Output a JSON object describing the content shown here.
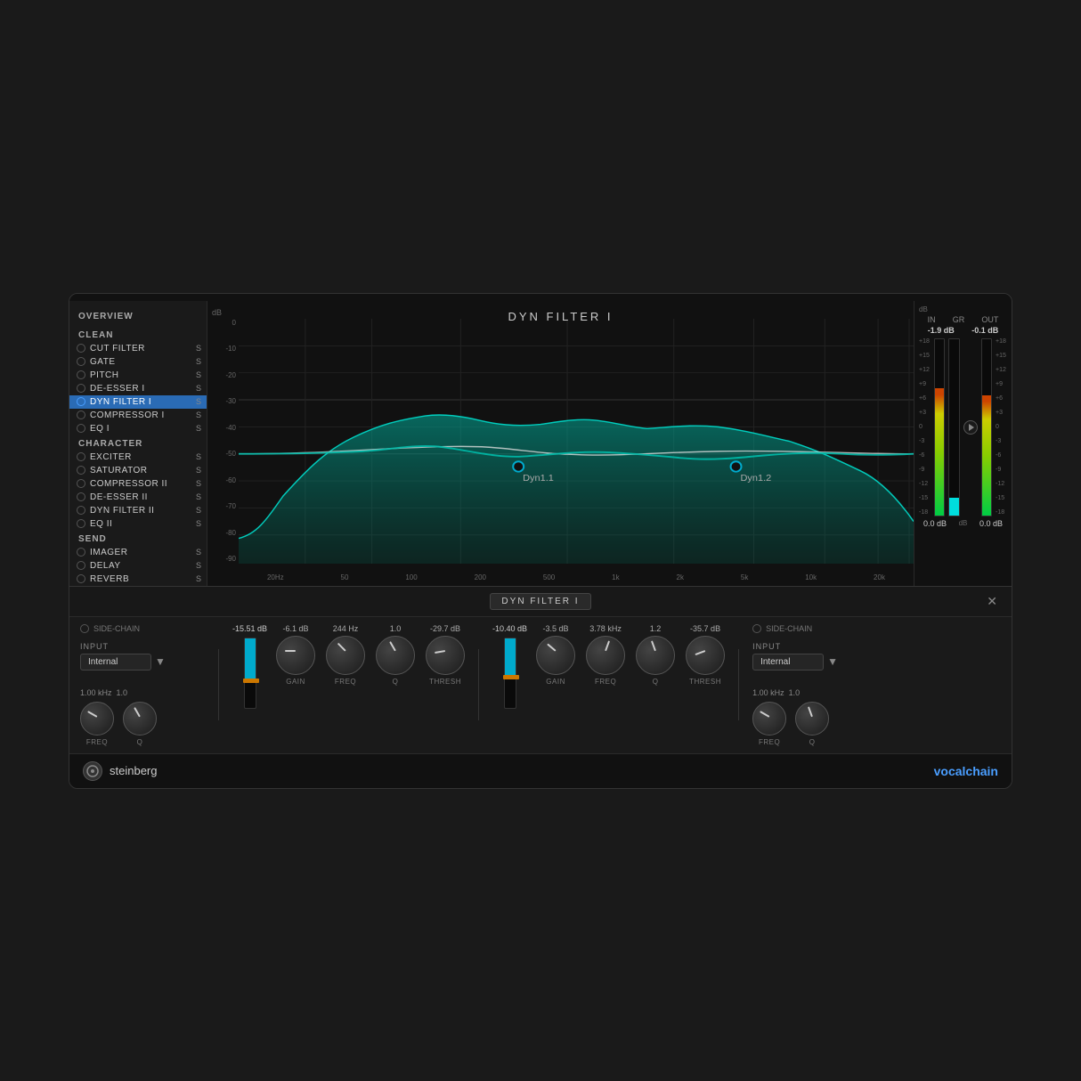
{
  "plugin": {
    "title": "DYN FILTER I",
    "footer": {
      "brand": "steinberg",
      "product_vocal": "vocal",
      "product_chain": "chain"
    }
  },
  "sidebar": {
    "overview": "OVERVIEW",
    "sections": [
      {
        "title": "CLEAN",
        "items": [
          {
            "id": "cut-filter",
            "label": "CUT FILTER",
            "active": false,
            "has_s": true
          },
          {
            "id": "gate",
            "label": "GATE",
            "active": false,
            "has_s": true
          },
          {
            "id": "pitch",
            "label": "PITCH",
            "active": false,
            "has_s": true
          },
          {
            "id": "de-esser-i",
            "label": "DE-ESSER I",
            "active": false,
            "has_s": true
          },
          {
            "id": "dyn-filter-i",
            "label": "DYN FILTER I",
            "active": true,
            "has_s": true
          },
          {
            "id": "compressor-i",
            "label": "COMPRESSOR I",
            "active": false,
            "has_s": true
          },
          {
            "id": "eq-i",
            "label": "EQ I",
            "active": false,
            "has_s": true
          }
        ]
      },
      {
        "title": "CHARACTER",
        "items": [
          {
            "id": "exciter",
            "label": "EXCITER",
            "active": false,
            "has_s": true
          },
          {
            "id": "saturator",
            "label": "SATURATOR",
            "active": false,
            "has_s": true
          },
          {
            "id": "compressor-ii",
            "label": "COMPRESSOR II",
            "active": false,
            "has_s": true
          },
          {
            "id": "de-esser-ii",
            "label": "DE-ESSER II",
            "active": false,
            "has_s": true
          },
          {
            "id": "dyn-filter-ii",
            "label": "DYN FILTER II",
            "active": false,
            "has_s": true
          },
          {
            "id": "eq-ii",
            "label": "EQ II",
            "active": false,
            "has_s": true
          }
        ]
      },
      {
        "title": "SEND",
        "items": [
          {
            "id": "imager",
            "label": "IMAGER",
            "active": false,
            "has_s": true
          },
          {
            "id": "delay",
            "label": "DELAY",
            "active": false,
            "has_s": true
          },
          {
            "id": "reverb",
            "label": "REVERB",
            "active": false,
            "has_s": true
          }
        ]
      }
    ]
  },
  "meters": {
    "in_label": "IN",
    "out_label": "OUT",
    "gr_label": "GR",
    "in_value": "-1.9 dB",
    "gr_value": "-0.1 dB",
    "out_label2": "OUT",
    "db_label": "dB",
    "scale": [
      "+18",
      "+15",
      "+12",
      "+9",
      "+6",
      "+3",
      "0",
      "-3",
      "-6",
      "-9",
      "-12",
      "-15",
      "-18"
    ],
    "bottom_in": "0.0 dB",
    "bottom_out": "0.0 dB"
  },
  "lower_panel": {
    "title": "DYN FILTER I",
    "close_btn": "✕",
    "dyn1": {
      "label": "Dyn1.1",
      "side_chain_label": "SIDE-CHAIN",
      "input_label": "INPUT",
      "input_value": "Internal",
      "freq_val": "1.00 kHz",
      "q_val": "1.0",
      "gain_label": "GAIN",
      "gain_value": "-6.1 dB",
      "freq_label": "FREQ",
      "freq_value": "244 Hz",
      "q_label": "Q",
      "q_value": "1.0",
      "thresh_label": "THRESH",
      "thresh_value": "-29.7 dB",
      "fader_value": "-15.51 dB"
    },
    "dyn2": {
      "label": "Dyn1.2",
      "side_chain_label": "SIDE-CHAIN",
      "input_label": "INPUT",
      "input_value": "Internal",
      "freq_val": "1.00 kHz",
      "q_val": "1.0",
      "gain_label": "GAIN",
      "gain_value": "-3.5 dB",
      "freq_label": "FREQ",
      "freq_value": "3.78 kHz",
      "q_label": "Q",
      "q_value": "1.2",
      "thresh_label": "THRESH",
      "thresh_value": "-35.7 dB",
      "fader_value": "-10.40 dB"
    }
  },
  "eq_display": {
    "db_scale": [
      "0",
      "-10",
      "-20",
      "-30",
      "-40",
      "-50",
      "-60",
      "-70",
      "-80",
      "-90"
    ],
    "freq_scale": [
      "20Hz",
      "50",
      "100",
      "200",
      "500",
      "1k",
      "2k",
      "5k",
      "10k",
      "20k"
    ],
    "db_top_label": "dB"
  }
}
